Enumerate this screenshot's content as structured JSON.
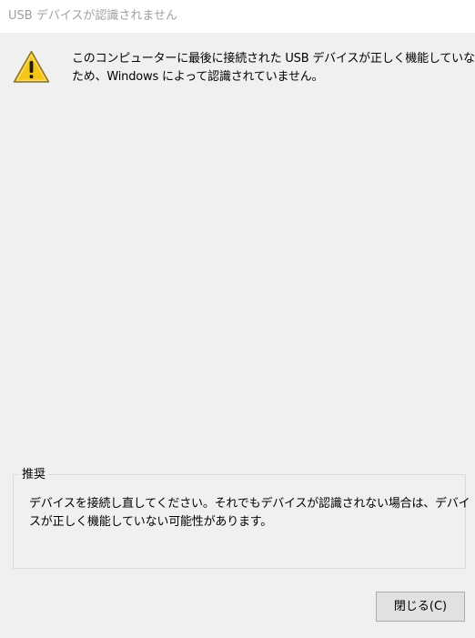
{
  "window": {
    "title": "USB デバイスが認識されません"
  },
  "message": {
    "line1": "このコンピューターに最後に接続された USB デバイスが正しく機能していない",
    "line2": "ため、Windows によって認識されていません。"
  },
  "recommendation": {
    "label": "推奨",
    "line1": "デバイスを接続し直してください。それでもデバイスが認識されない場合は、デバイ",
    "line2": "スが正しく機能していない可能性があります。"
  },
  "buttons": {
    "close_label": "閉じる(C)"
  },
  "icons": {
    "warning": "warning-icon"
  },
  "colors": {
    "background": "#f0f0f0",
    "title_bar": "#ffffff",
    "title_text": "#a0a0a0",
    "warning_fill": "#f5c518",
    "button_face": "#e1e1e1",
    "button_border": "#adadad"
  }
}
